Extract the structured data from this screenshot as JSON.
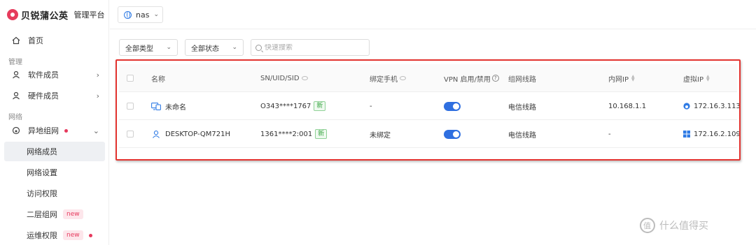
{
  "brand": {
    "name": "贝锐蒲公英",
    "subtitle": "管理平台"
  },
  "sidebar": {
    "home": "首页",
    "sections": {
      "manage": "管理",
      "network": "网络"
    },
    "items": [
      {
        "label": "软件成员"
      },
      {
        "label": "硬件成员"
      },
      {
        "label": "异地组网"
      }
    ],
    "sub_items": [
      {
        "label": "网络成员"
      },
      {
        "label": "网络设置"
      },
      {
        "label": "访问权限"
      },
      {
        "label": "二层组网",
        "badge": "new"
      },
      {
        "label": "运维权限",
        "badge": "new"
      }
    ]
  },
  "topbar": {
    "network_name": "nas"
  },
  "filters": {
    "type": "全部类型",
    "status": "全部状态",
    "search_placeholder": "快速搜索"
  },
  "table": {
    "headers": {
      "name": "名称",
      "sn": "SN/UID/SID",
      "phone": "绑定手机",
      "vpn": "VPN 启用/禁用",
      "line": "组网线路",
      "lan_ip": "内网IP",
      "virtual_ip": "虚拟IP"
    },
    "rows": [
      {
        "name": "未命名",
        "sn": "O343****1767",
        "tag": "新",
        "phone": "-",
        "vpn_enabled": true,
        "line": "电信线路",
        "lan_ip": "10.168.1.1",
        "virtual_ip": "172.16.3.113",
        "os_icon": "globe-os-icon"
      },
      {
        "name": "DESKTOP-QM721H",
        "sn": "1361****2:001",
        "tag": "新",
        "phone": "未绑定",
        "vpn_enabled": true,
        "line": "电信线路",
        "lan_ip": "-",
        "virtual_ip": "172.16.2.109",
        "os_icon": "windows-icon"
      }
    ]
  },
  "watermark": "什么值得买",
  "colors": {
    "accent": "#2f6fe0",
    "brand": "#e63b5c",
    "highlight_border": "#e3332f",
    "tag_green": "#3aa643"
  }
}
